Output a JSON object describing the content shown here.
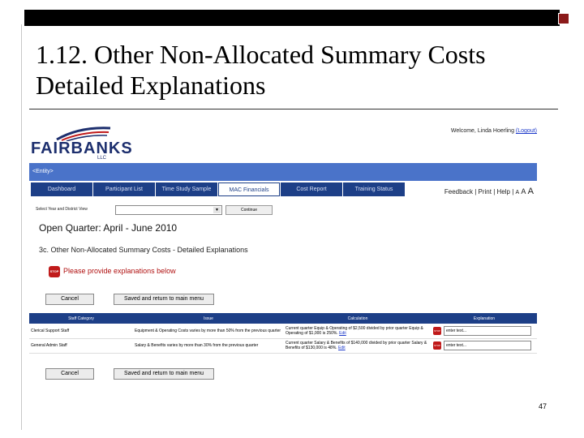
{
  "slide": {
    "title_line1": "1.12. Other Non-Allocated Summary Costs",
    "title_line2": "Detailed Explanations",
    "page_number": "47"
  },
  "app": {
    "logo_text": "FAIRBANKS",
    "logo_llc": "LLC",
    "welcome_text": "Welcome, Linda Hoerling",
    "logout_label": "(Logout)",
    "entity_label": "<Entity>",
    "nav_tabs": [
      {
        "label": "Dashboard",
        "active": false
      },
      {
        "label": "Participant List",
        "active": false
      },
      {
        "label": "Time Study Sample",
        "active": false
      },
      {
        "label": "MAC Financials",
        "active": true
      },
      {
        "label": "Cost Report",
        "active": false
      },
      {
        "label": "Training Status",
        "active": false
      }
    ],
    "utility": {
      "feedback": "Feedback",
      "print": "Print",
      "help": "Help",
      "font_small": "A",
      "font_medium": "A",
      "font_large": "A"
    },
    "select_label": "Select Year and District View",
    "select_value": "",
    "continue_label": "Continue",
    "open_quarter": "Open Quarter: April - June 2010",
    "section_title": "3c.  Other Non-Allocated Summary Costs - Detailed Explanations",
    "stop_icon_text": "STOP",
    "stop_message": "Please provide explanations below",
    "cancel_label": "Cancel",
    "save_label": "Saved and return to main menu",
    "table": {
      "headers": [
        "Staff Category",
        "Issue",
        "Calculation",
        "Explanation"
      ],
      "rows": [
        {
          "category": "Clerical Support Staff",
          "issue": "Equipment & Operating Costs varies by more than 50% from the previous quarter",
          "calculation": "Current quarter Equip & Operating of $2,500 divided by prior quarter Equip & Operating of $1,000 is 250%.",
          "edit_label": "Edit",
          "explanation_placeholder": "enter text..."
        },
        {
          "category": "General Admin Staff",
          "issue": "Salary & Benefits varies by more than 30% from the previous quarter",
          "calculation": "Current quarter Salary & Benefits of $140,000 divided by prior quarter Salary & Benefits of $130,000 is 48%.",
          "edit_label": "Edit",
          "explanation_placeholder": "enter text..."
        }
      ]
    }
  }
}
